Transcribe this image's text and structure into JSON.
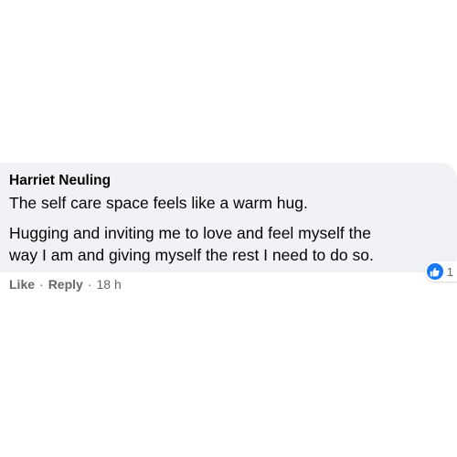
{
  "comment": {
    "author": "Harriet Neuling",
    "paragraphs": [
      "The self care space feels like a warm hug.",
      "Hugging and inviting me to love and feel myself the",
      "way I am and giving myself the rest I need to do so."
    ],
    "reaction": {
      "icon": "thumbs-up-icon",
      "count": "1",
      "color": "#1877f2"
    },
    "actions": {
      "like_label": "Like",
      "reply_label": "Reply",
      "separator": "·",
      "timestamp": "18 h"
    }
  }
}
